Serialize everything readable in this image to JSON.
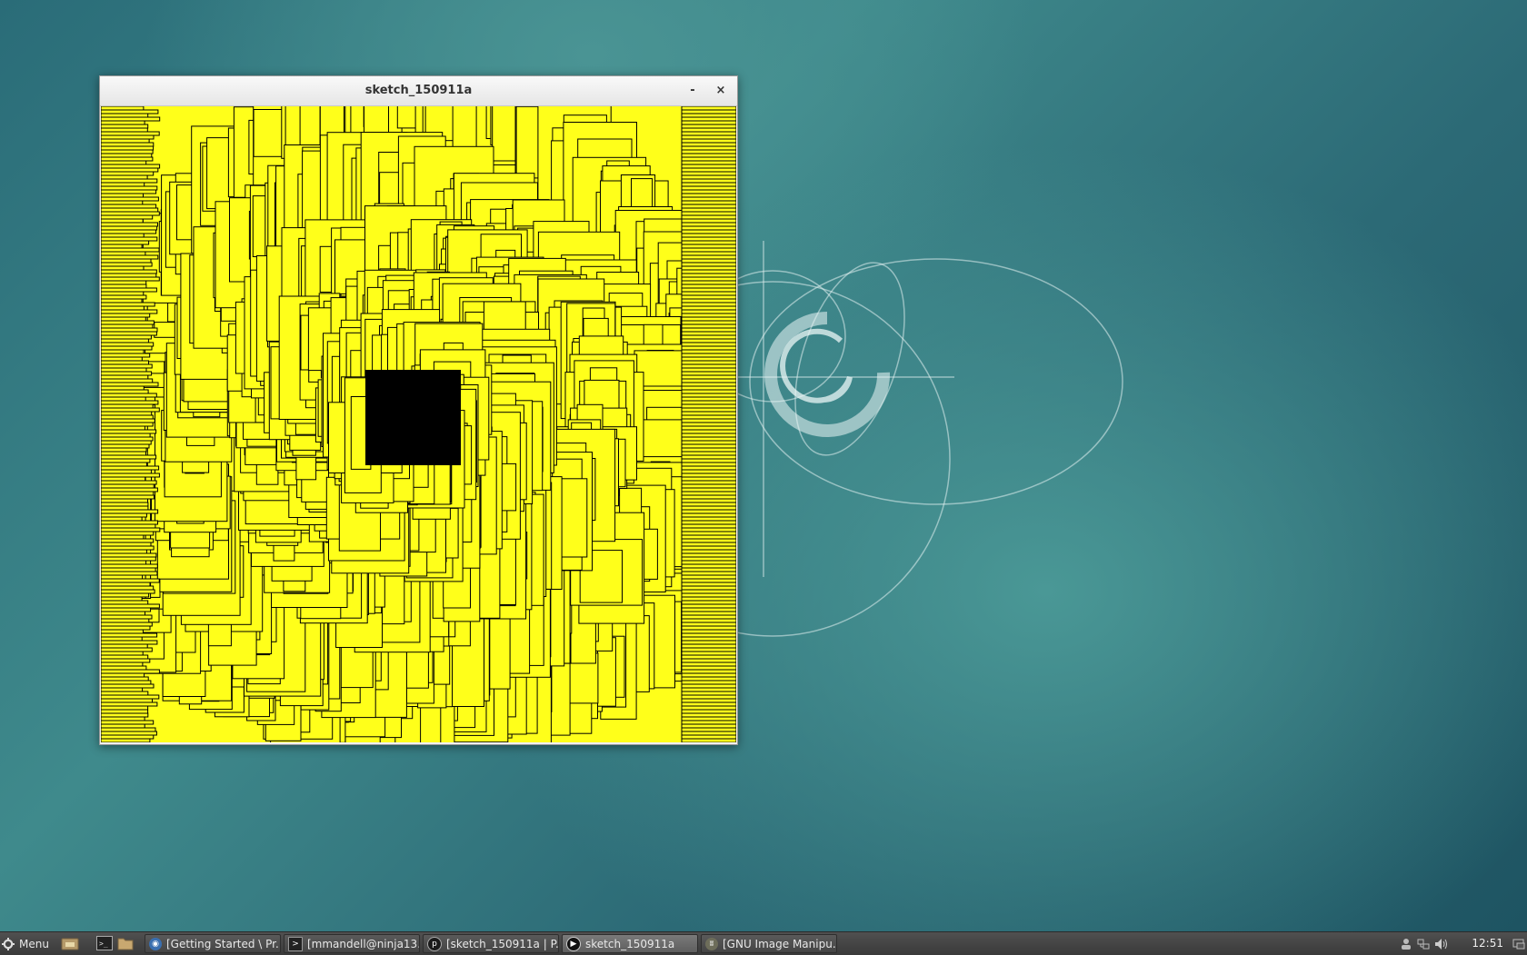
{
  "window": {
    "title": "sketch_150911a",
    "minimize_label": "-",
    "close_label": "×"
  },
  "sketch": {
    "fill_color": "#ffff1a",
    "stroke_color": "#000000",
    "content": "yellow rectangles with black outlines drawn along swirling paths"
  },
  "taskbar": {
    "menu_label": "Menu",
    "tasks": [
      {
        "label": "[Getting Started \\ Pr...",
        "icon": "browser-icon",
        "active": false
      },
      {
        "label": "[mmandell@ninja13...",
        "icon": "terminal-icon",
        "active": false
      },
      {
        "label": "[sketch_150911a | P...",
        "icon": "processing-icon",
        "active": false
      },
      {
        "label": "sketch_150911a",
        "icon": "play-icon",
        "active": true
      },
      {
        "label": "[GNU Image Manipu...",
        "icon": "gimp-icon",
        "active": false
      }
    ],
    "clock": "12:51",
    "tray_icons": [
      "user-icon",
      "network-icon",
      "volume-icon",
      "display-icon"
    ]
  },
  "colors": {
    "taskbar_bg": "#3f3f3f",
    "desktop_teal": "#3f8a8c"
  }
}
